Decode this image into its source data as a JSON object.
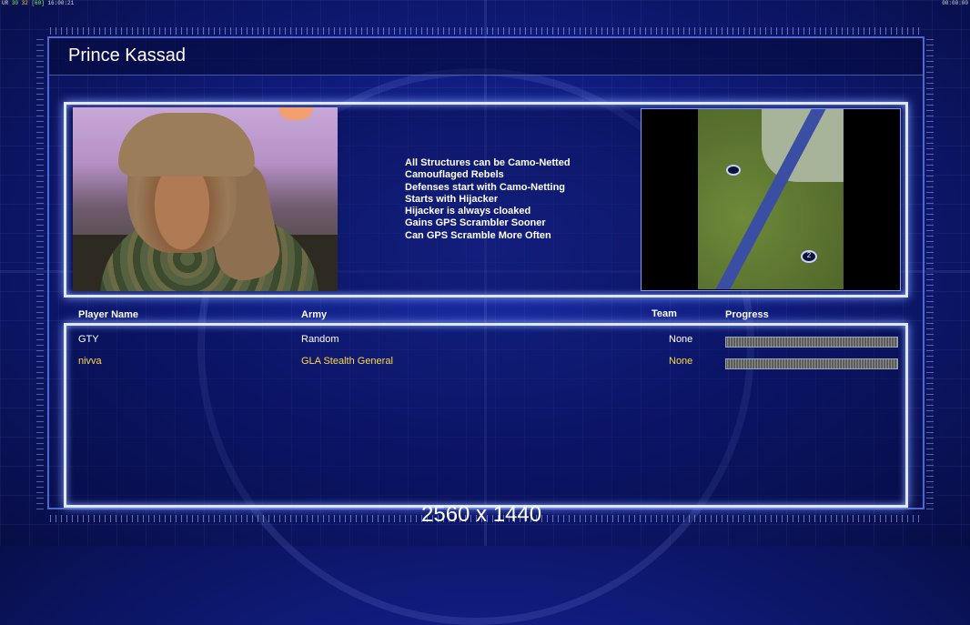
{
  "hud": {
    "top_left": [
      "UR",
      "30",
      "32",
      "[60]",
      "16:00:21"
    ],
    "top_right": "00:00:00"
  },
  "general": {
    "name": "Prince Kassad",
    "traits": [
      "All Structures can be Camo-Netted",
      "Camouflaged Rebels",
      "Defenses start with Camo-Netting",
      "Starts with Hijacker",
      "Hijacker is always cloaked",
      "Gains GPS Scrambler Sooner",
      "Can GPS Scramble More Often"
    ]
  },
  "minimap": {
    "markers": [
      "",
      "2"
    ]
  },
  "table": {
    "headers": {
      "player_name": "Player Name",
      "army": "Army",
      "team": "Team",
      "progress": "Progress"
    },
    "rows": [
      {
        "player": "GTY",
        "army": "Random",
        "team": "None",
        "color": "#ffffff",
        "progress": 1.0
      },
      {
        "player": "nivva",
        "army": "GLA Stealth General",
        "team": "None",
        "color": "#ffd84a",
        "progress": 1.0
      }
    ]
  },
  "overlay": {
    "resolution": "2560 x 1440"
  }
}
